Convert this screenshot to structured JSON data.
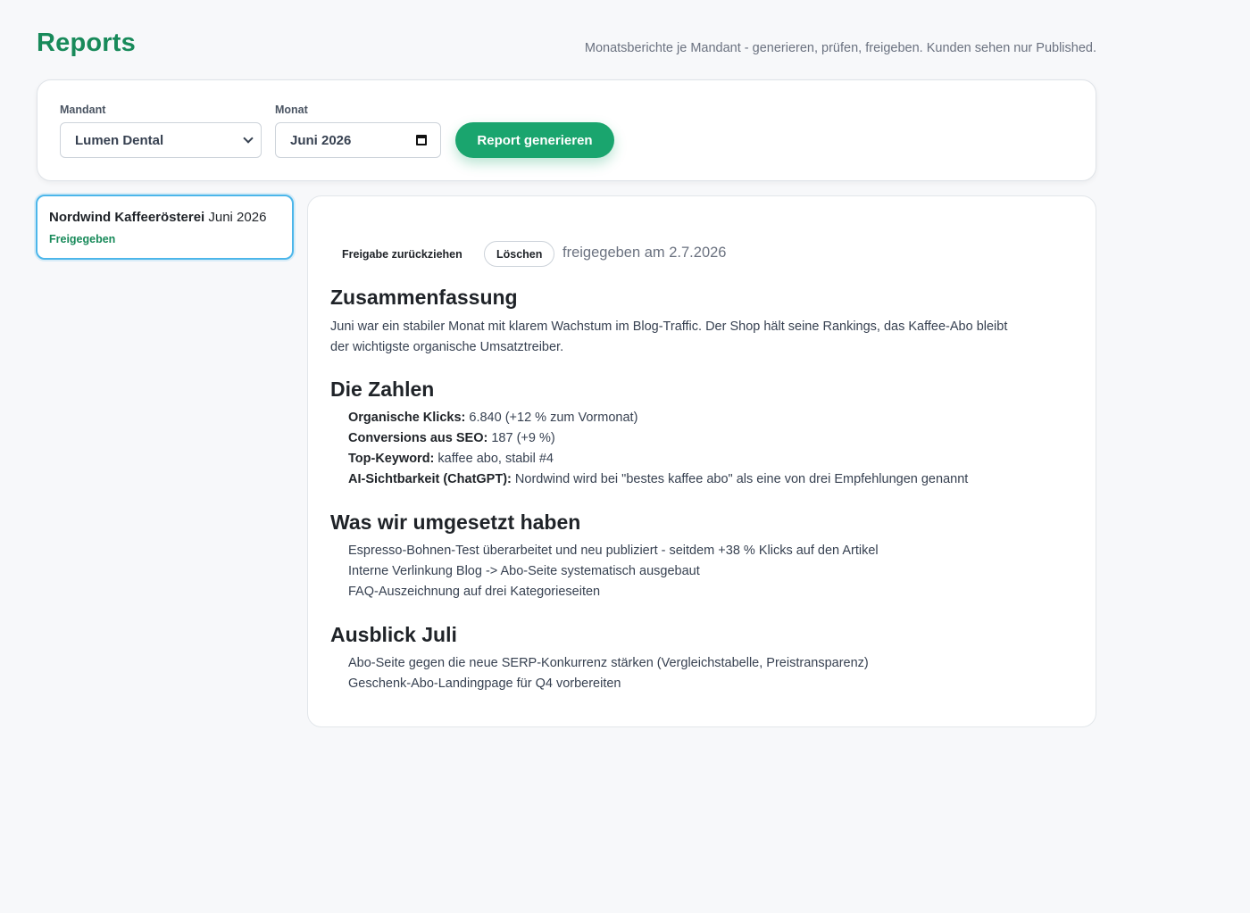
{
  "header": {
    "title": "Reports",
    "subtitle": "Monatsberichte je Mandant - generieren, prüfen, freigeben. Kunden sehen nur Published."
  },
  "filters": {
    "mandant_label": "Mandant",
    "mandant_value": "Lumen Dental",
    "monat_label": "Monat",
    "monat_value": "Juni 2026",
    "generate_label": "Report generieren"
  },
  "report_list": [
    {
      "client": "Nordwind Kaffeerösterei",
      "period": "Juni 2026",
      "status": "Freigegeben"
    }
  ],
  "report": {
    "actions": {
      "withdraw_label": "Freigabe zurückziehen",
      "delete_label": "Löschen",
      "released_note": "freigegeben am 2.7.2026"
    },
    "summary": {
      "heading": "Zusammenfassung",
      "text": "Juni war ein stabiler Monat mit klarem Wachstum im Blog-Traffic. Der Shop hält seine Rankings, das Kaffee-Abo bleibt der wichtigste organische Umsatztreiber."
    },
    "numbers": {
      "heading": "Die Zahlen",
      "items": [
        {
          "label": "Organische Klicks:",
          "value": "6.840 (+12 % zum Vormonat)"
        },
        {
          "label": "Conversions aus SEO:",
          "value": "187 (+9 %)"
        },
        {
          "label": "Top-Keyword:",
          "value": "kaffee abo, stabil #4"
        },
        {
          "label": "AI-Sichtbarkeit (ChatGPT):",
          "value": "Nordwind wird bei \"bestes kaffee abo\" als eine von drei Empfehlungen genannt"
        }
      ]
    },
    "done": {
      "heading": "Was wir umgesetzt haben",
      "items": [
        "Espresso-Bohnen-Test überarbeitet und neu publiziert - seitdem +38 % Klicks auf den Artikel",
        "Interne Verlinkung Blog -> Abo-Seite systematisch ausgebaut",
        "FAQ-Auszeichnung auf drei Kategorieseiten"
      ]
    },
    "outlook": {
      "heading": "Ausblick Juli",
      "items": [
        "Abo-Seite gegen die neue SERP-Konkurrenz stärken (Vergleichstabelle, Preistransparenz)",
        "Geschenk-Abo-Landingpage für Q4 vorbereiten"
      ]
    }
  }
}
